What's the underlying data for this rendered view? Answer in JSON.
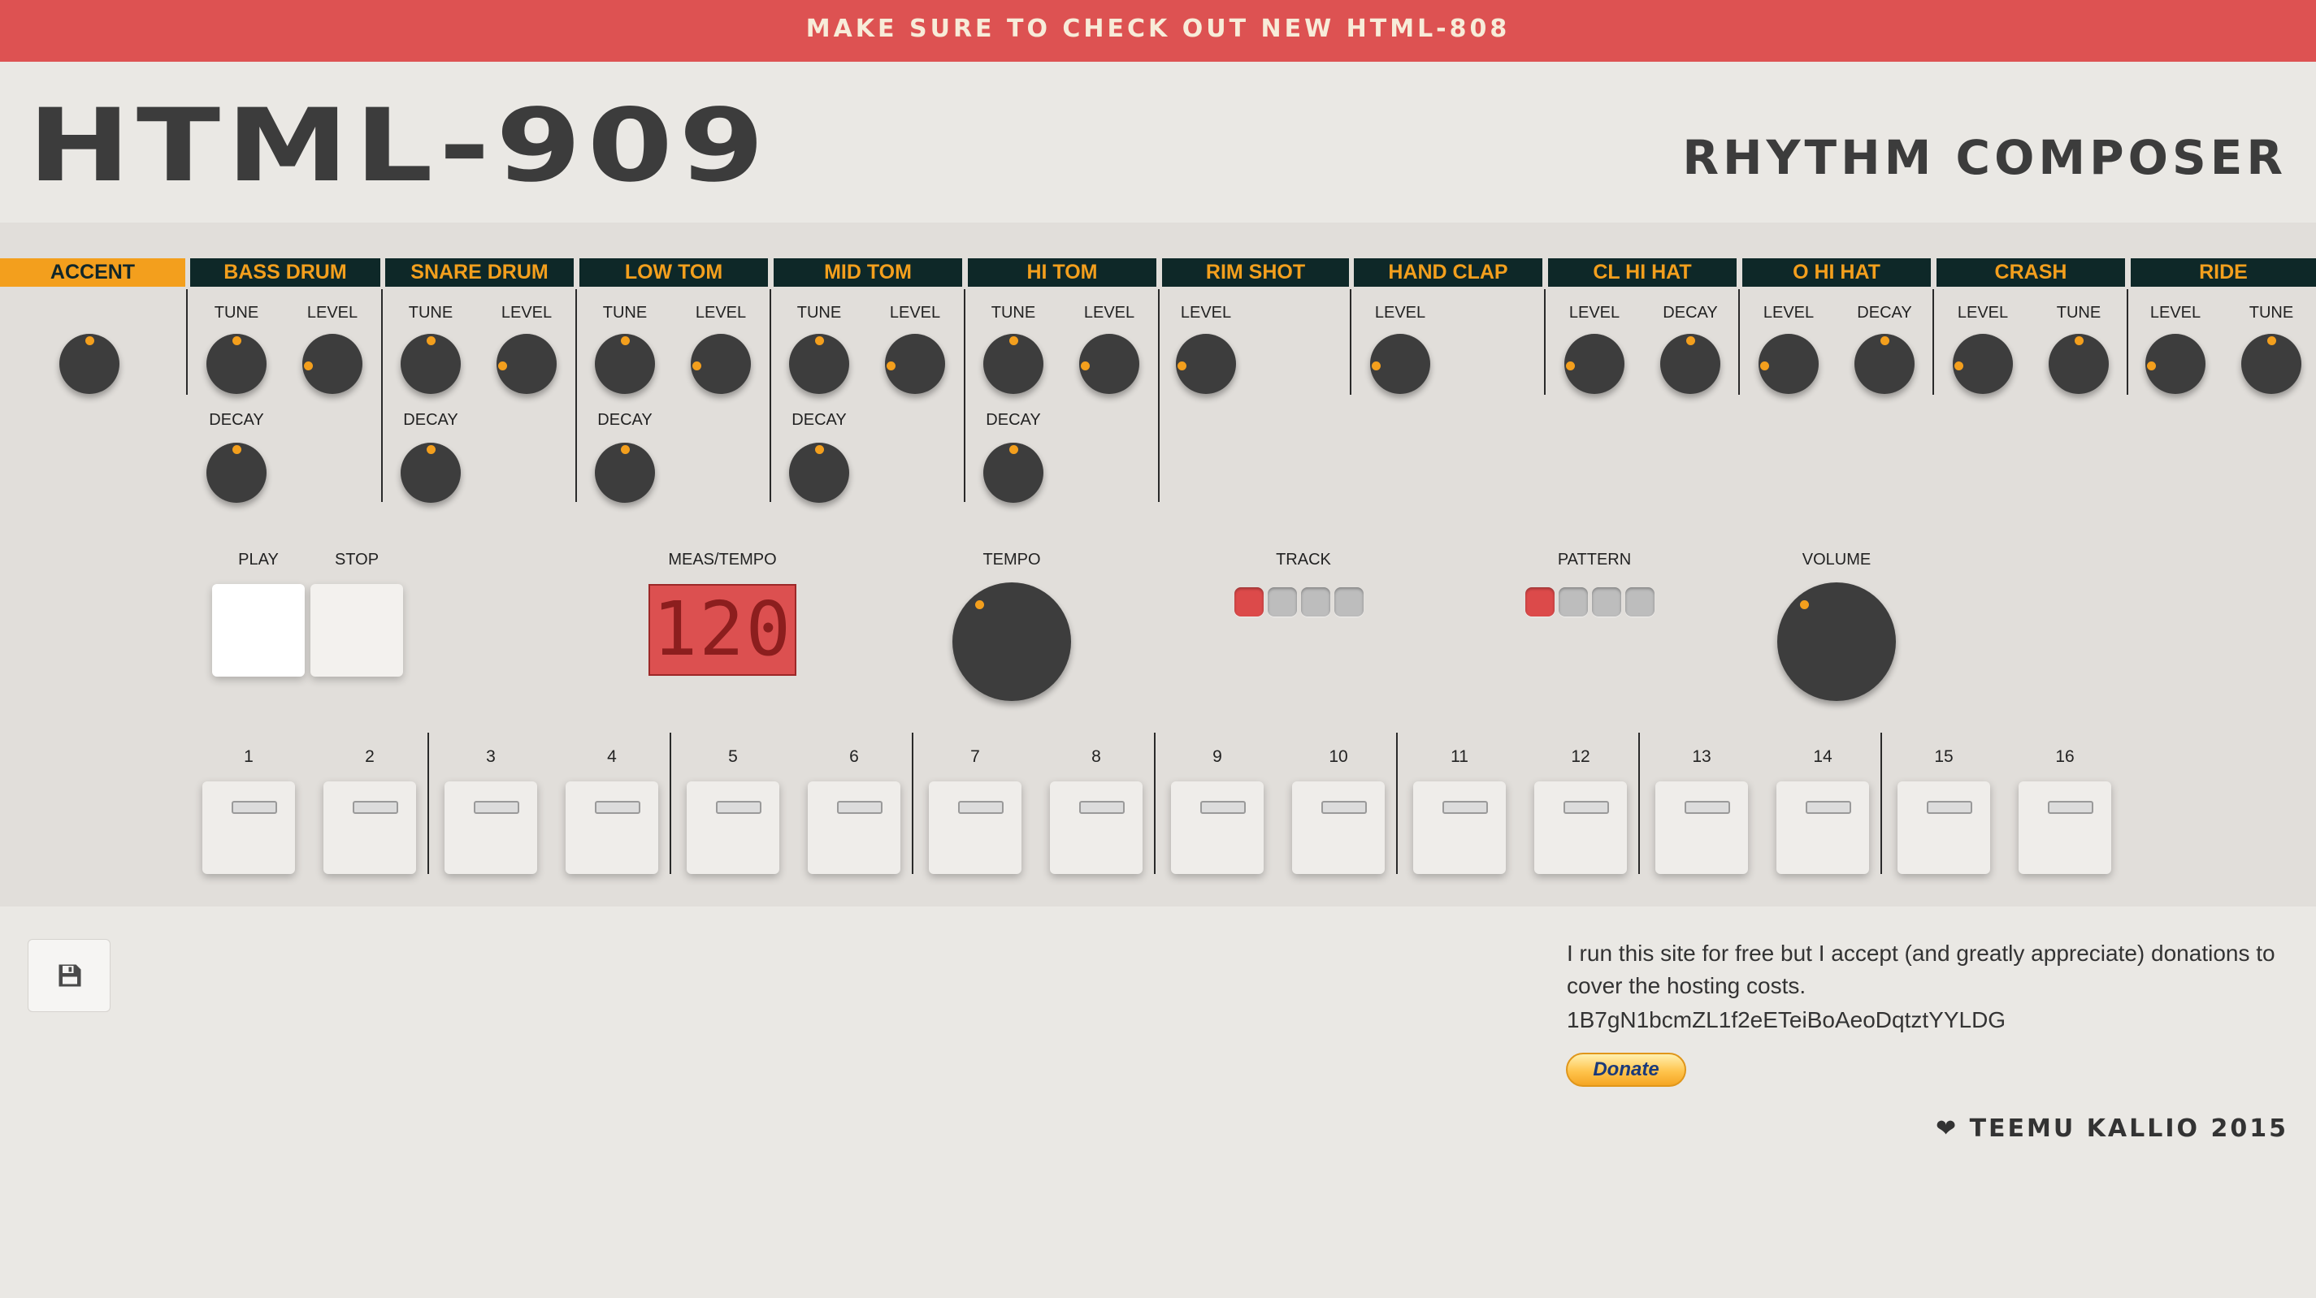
{
  "banner": "MAKE SURE TO CHECK OUT NEW HTML-808",
  "logo": "HTML-909",
  "subtitle": "RHYTHM COMPOSER",
  "colors": {
    "banner": "#dd5252",
    "accent": "#f39f1d",
    "channel_header": "#0e2828",
    "knob": "#3d3d3d",
    "display": "#dc5050",
    "led_on": "#dc4a4a",
    "led_off": "#bdbdbd"
  },
  "channels": [
    {
      "name": "ACCENT",
      "knobs": [
        "ACCENT"
      ]
    },
    {
      "name": "BASS DRUM",
      "knobs": [
        "TUNE",
        "LEVEL",
        "DECAY"
      ]
    },
    {
      "name": "SNARE DRUM",
      "knobs": [
        "TUNE",
        "LEVEL",
        "DECAY"
      ]
    },
    {
      "name": "LOW TOM",
      "knobs": [
        "TUNE",
        "LEVEL",
        "DECAY"
      ]
    },
    {
      "name": "MID TOM",
      "knobs": [
        "TUNE",
        "LEVEL",
        "DECAY"
      ]
    },
    {
      "name": "HI TOM",
      "knobs": [
        "TUNE",
        "LEVEL",
        "DECAY"
      ]
    },
    {
      "name": "RIM SHOT",
      "knobs": [
        "LEVEL"
      ]
    },
    {
      "name": "HAND CLAP",
      "knobs": [
        "LEVEL"
      ]
    },
    {
      "name": "CL HI HAT",
      "knobs": [
        "LEVEL",
        "DECAY"
      ]
    },
    {
      "name": "O HI HAT",
      "knobs": [
        "LEVEL",
        "DECAY"
      ]
    },
    {
      "name": "CRASH",
      "knobs": [
        "LEVEL",
        "TUNE"
      ]
    },
    {
      "name": "RIDE",
      "knobs": [
        "LEVEL",
        "TUNE"
      ]
    }
  ],
  "controls": {
    "play_label": "PLAY",
    "stop_label": "STOP",
    "meas_label": "MEAS/TEMPO",
    "display_value": "120",
    "tempo_label": "TEMPO",
    "track_label": "TRACK",
    "pattern_label": "PATTERN",
    "volume_label": "VOLUME",
    "track_active": 1,
    "pattern_active": 1,
    "track_count": 4,
    "pattern_count": 4
  },
  "steps": [
    "1",
    "2",
    "3",
    "4",
    "5",
    "6",
    "7",
    "8",
    "9",
    "10",
    "11",
    "12",
    "13",
    "14",
    "15",
    "16"
  ],
  "footer": {
    "save_icon": "floppy-disk-icon",
    "donate_text": "I run this site for free but I accept (and greatly appreciate) donations to cover the hosting costs.",
    "address": "1B7gN1bcmZL1f2eETeiBoAeoDqtztYYLDG",
    "donate_label": "Donate",
    "credit": "❤ TEEMU KALLIO 2015"
  }
}
